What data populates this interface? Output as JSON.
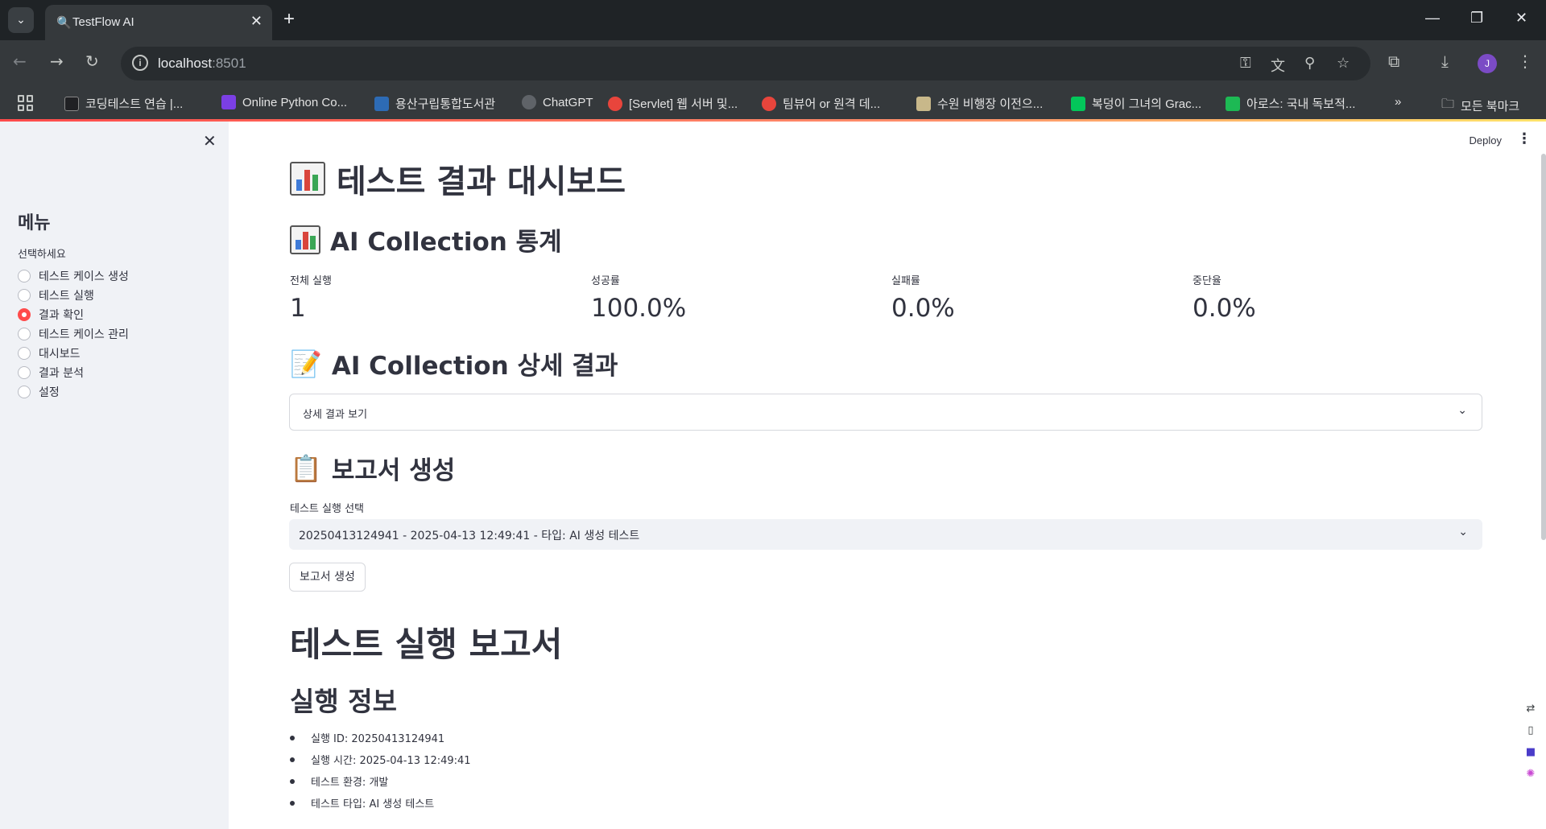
{
  "browser": {
    "tab_title": "TestFlow AI",
    "url_host": "localhost",
    "url_port": ":8501",
    "bookmarks": [
      {
        "label": "코딩테스트 연습 |...",
        "icon_color": "#202124",
        "icon": "programmers-icon"
      },
      {
        "label": "Online Python Co...",
        "icon_color": "#7b3fe4",
        "icon": "python-compiler-icon"
      },
      {
        "label": "용산구립통합도서관",
        "icon_color": "#2d6bb5",
        "icon": "library-icon"
      },
      {
        "label": "ChatGPT",
        "icon_color": "#5f6368",
        "icon": "chatgpt-icon"
      },
      {
        "label": "[Servlet] 웹 서버 및...",
        "icon_color": "#e8453c",
        "icon": "tistory-icon"
      },
      {
        "label": "팀뷰어 or 원격 데...",
        "icon_color": "#e8453c",
        "icon": "tistory-icon"
      },
      {
        "label": "수원 비행장 이전으...",
        "icon_color": "#c8b88a",
        "icon": "document-icon"
      },
      {
        "label": "복덩이 그녀의 Grac...",
        "icon_color": "#03c75a",
        "icon": "blog-icon"
      },
      {
        "label": "아로스: 국내 독보적...",
        "icon_color": "#1db954",
        "icon": "aros-icon"
      }
    ],
    "all_bookmarks": "모든 북마크",
    "profile_initial": "J"
  },
  "sidebar": {
    "title": "메뉴",
    "select_label": "선택하세요",
    "options": [
      {
        "label": "테스트 케이스 생성",
        "selected": false
      },
      {
        "label": "테스트 실행",
        "selected": false
      },
      {
        "label": "결과 확인",
        "selected": true
      },
      {
        "label": "테스트 케이스 관리",
        "selected": false
      },
      {
        "label": "대시보드",
        "selected": false
      },
      {
        "label": "결과 분석",
        "selected": false
      },
      {
        "label": "설정",
        "selected": false
      }
    ]
  },
  "header": {
    "deploy": "Deploy"
  },
  "main": {
    "title": "테스트 결과 대시보드",
    "stats_title": "AI Collection 통계",
    "metrics": [
      {
        "label": "전체 실행",
        "value": "1"
      },
      {
        "label": "성공률",
        "value": "100.0%"
      },
      {
        "label": "실패률",
        "value": "0.0%"
      },
      {
        "label": "중단율",
        "value": "0.0%"
      }
    ],
    "detail_title": "AI Collection 상세 결과",
    "expander_label": "상세 결과 보기",
    "report_section_title": "보고서 생성",
    "select_label": "테스트 실행 선택",
    "select_value": "20250413124941 - 2025-04-13 12:49:41 - 타입: AI 생성 테스트",
    "generate_button": "보고서 생성",
    "report_title": "테스트 실행 보고서",
    "run_info_title": "실행 정보",
    "run_info": [
      "실행 ID: 20250413124941",
      "실행 시간: 2025-04-13 12:49:41",
      "테스트 환경: 개발",
      "테스트 타입: AI 생성 테스트"
    ]
  }
}
